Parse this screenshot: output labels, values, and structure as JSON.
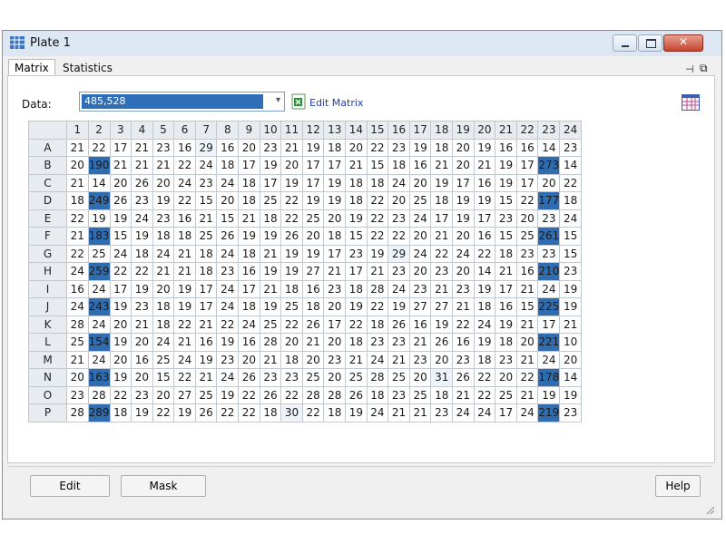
{
  "window": {
    "title": "Plate 1"
  },
  "tabs": [
    {
      "label": "Matrix"
    },
    {
      "label": "Statistics"
    }
  ],
  "data_label": "Data:",
  "data_select": {
    "value": "485,528"
  },
  "edit_matrix_label": "Edit Matrix",
  "columns": [
    "1",
    "2",
    "3",
    "4",
    "5",
    "6",
    "7",
    "8",
    "9",
    "10",
    "11",
    "12",
    "13",
    "14",
    "15",
    "16",
    "17",
    "18",
    "19",
    "20",
    "21",
    "22",
    "23",
    "24"
  ],
  "rows": [
    {
      "label": "A",
      "values": [
        21,
        22,
        17,
        21,
        23,
        16,
        29,
        16,
        20,
        23,
        21,
        19,
        18,
        20,
        22,
        23,
        19,
        18,
        20,
        19,
        16,
        16,
        14,
        23
      ]
    },
    {
      "label": "B",
      "values": [
        20,
        190,
        21,
        21,
        21,
        22,
        24,
        18,
        17,
        19,
        20,
        17,
        17,
        21,
        15,
        18,
        16,
        21,
        20,
        21,
        19,
        17,
        273,
        14
      ]
    },
    {
      "label": "C",
      "values": [
        21,
        14,
        20,
        26,
        20,
        24,
        23,
        24,
        18,
        17,
        19,
        17,
        19,
        18,
        18,
        24,
        20,
        19,
        17,
        16,
        19,
        17,
        20,
        22
      ]
    },
    {
      "label": "D",
      "values": [
        18,
        249,
        26,
        23,
        19,
        22,
        15,
        20,
        18,
        25,
        22,
        19,
        19,
        18,
        22,
        20,
        25,
        18,
        19,
        19,
        15,
        22,
        177,
        18
      ]
    },
    {
      "label": "E",
      "values": [
        22,
        19,
        19,
        24,
        23,
        16,
        21,
        15,
        21,
        18,
        22,
        25,
        20,
        19,
        22,
        23,
        24,
        17,
        19,
        17,
        23,
        20,
        23,
        24
      ]
    },
    {
      "label": "F",
      "values": [
        21,
        183,
        15,
        19,
        18,
        18,
        25,
        26,
        19,
        19,
        26,
        20,
        18,
        15,
        22,
        22,
        20,
        21,
        20,
        16,
        15,
        25,
        261,
        15
      ]
    },
    {
      "label": "G",
      "values": [
        22,
        25,
        24,
        18,
        24,
        21,
        18,
        24,
        18,
        21,
        19,
        19,
        17,
        23,
        19,
        29,
        24,
        22,
        24,
        22,
        18,
        23,
        23,
        15
      ]
    },
    {
      "label": "H",
      "values": [
        24,
        259,
        22,
        22,
        21,
        21,
        18,
        23,
        16,
        19,
        19,
        27,
        21,
        17,
        21,
        23,
        20,
        23,
        20,
        14,
        21,
        16,
        210,
        23
      ]
    },
    {
      "label": "I",
      "values": [
        16,
        24,
        17,
        19,
        20,
        19,
        17,
        24,
        17,
        21,
        18,
        16,
        23,
        18,
        28,
        24,
        23,
        21,
        23,
        19,
        17,
        21,
        24,
        19
      ]
    },
    {
      "label": "J",
      "values": [
        24,
        243,
        19,
        23,
        18,
        19,
        17,
        24,
        18,
        19,
        25,
        18,
        20,
        19,
        22,
        19,
        27,
        27,
        21,
        18,
        16,
        15,
        225,
        19
      ]
    },
    {
      "label": "K",
      "values": [
        28,
        24,
        20,
        21,
        18,
        22,
        21,
        22,
        24,
        25,
        22,
        26,
        17,
        22,
        18,
        26,
        16,
        19,
        22,
        24,
        19,
        21,
        17,
        21
      ]
    },
    {
      "label": "L",
      "values": [
        25,
        154,
        19,
        20,
        24,
        21,
        16,
        19,
        16,
        28,
        20,
        21,
        20,
        18,
        23,
        23,
        21,
        26,
        16,
        19,
        18,
        20,
        221,
        10
      ]
    },
    {
      "label": "M",
      "values": [
        21,
        24,
        20,
        16,
        25,
        24,
        19,
        23,
        20,
        21,
        18,
        20,
        23,
        21,
        24,
        21,
        23,
        20,
        23,
        18,
        23,
        21,
        24,
        20
      ]
    },
    {
      "label": "N",
      "values": [
        20,
        163,
        19,
        20,
        15,
        22,
        21,
        24,
        26,
        23,
        23,
        25,
        20,
        25,
        28,
        25,
        20,
        31,
        26,
        22,
        20,
        22,
        178,
        14
      ]
    },
    {
      "label": "O",
      "values": [
        23,
        28,
        22,
        23,
        20,
        27,
        25,
        19,
        22,
        26,
        22,
        28,
        28,
        26,
        18,
        23,
        25,
        18,
        21,
        22,
        25,
        21,
        19,
        19
      ]
    },
    {
      "label": "P",
      "values": [
        28,
        289,
        18,
        19,
        22,
        19,
        26,
        22,
        22,
        18,
        30,
        22,
        18,
        19,
        24,
        21,
        21,
        23,
        24,
        24,
        17,
        24,
        219,
        23
      ]
    }
  ],
  "buttons": {
    "edit": "Edit",
    "mask": "Mask",
    "help": "Help"
  },
  "colors": {
    "highlight_strong": "#2f6db0",
    "highlight_medium": "#d7e6f4",
    "highlight_light": "#eef4fa",
    "accent": "#2f6fba"
  }
}
